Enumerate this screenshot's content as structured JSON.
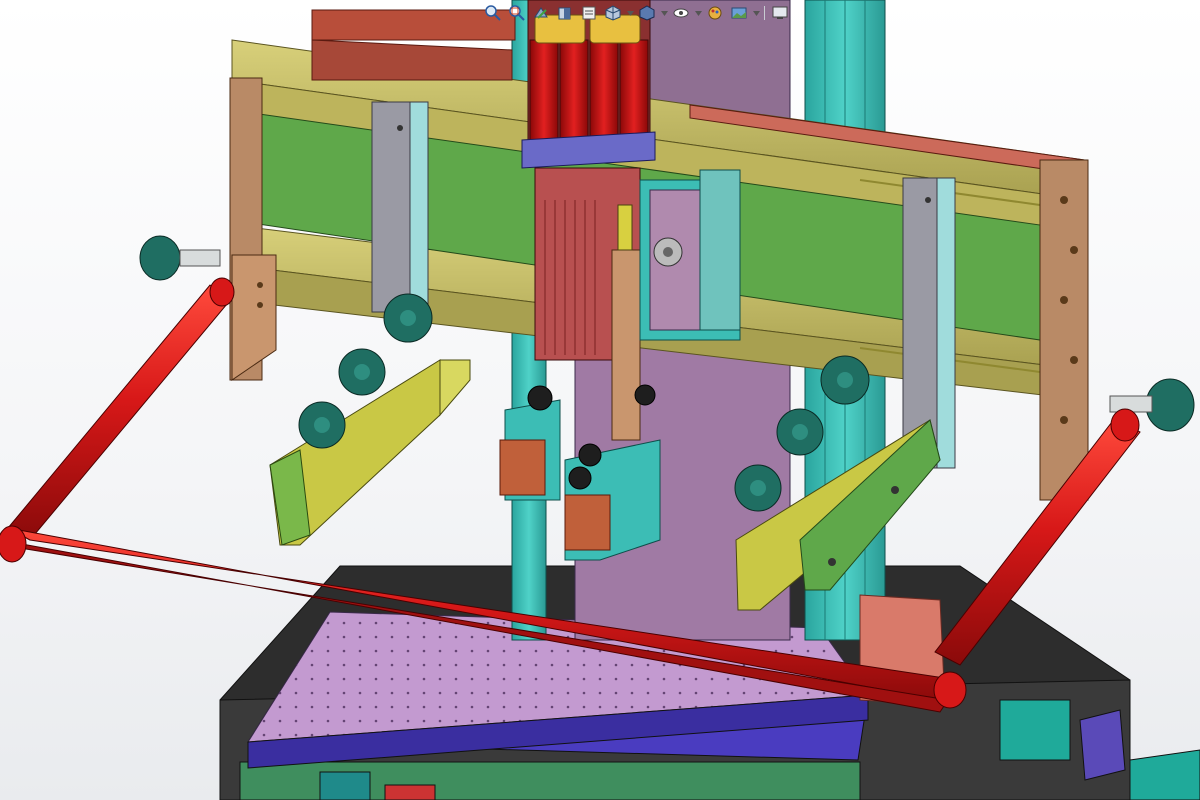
{
  "viewport": {
    "background_top": "#ffffff",
    "background_bottom": "#e9ebee"
  },
  "hud_toolbar": {
    "items": [
      {
        "icon": "zoom-to-fit-icon"
      },
      {
        "icon": "zoom-to-area-icon"
      },
      {
        "icon": "previous-view-icon"
      },
      {
        "icon": "section-view-icon"
      },
      {
        "icon": "dynamic-annotation-icon"
      },
      {
        "icon": "view-orientation-icon"
      },
      {
        "icon": "display-style-icon"
      },
      {
        "icon": "hide-show-items-icon"
      },
      {
        "icon": "edit-appearance-icon"
      },
      {
        "icon": "apply-scene-icon"
      },
      {
        "icon": "view-settings-icon"
      }
    ]
  },
  "model": {
    "part_colors": {
      "frame_handle": "#d71818",
      "rail_beam": "#c8c06a",
      "green_plate": "#5fa84a",
      "column": "#3cbdb5",
      "carriage_plate": "#8a6a8a",
      "mauve_panel": "#b08aae",
      "side_bracket": "#b98a66",
      "knob": "#1f6e62",
      "clamp_bar": "#c9c845",
      "upright": "#9a9aa4",
      "worktable": "#c39ad0",
      "base": "#2a2a2a",
      "fixture_blue": "#4a3cc0"
    }
  }
}
